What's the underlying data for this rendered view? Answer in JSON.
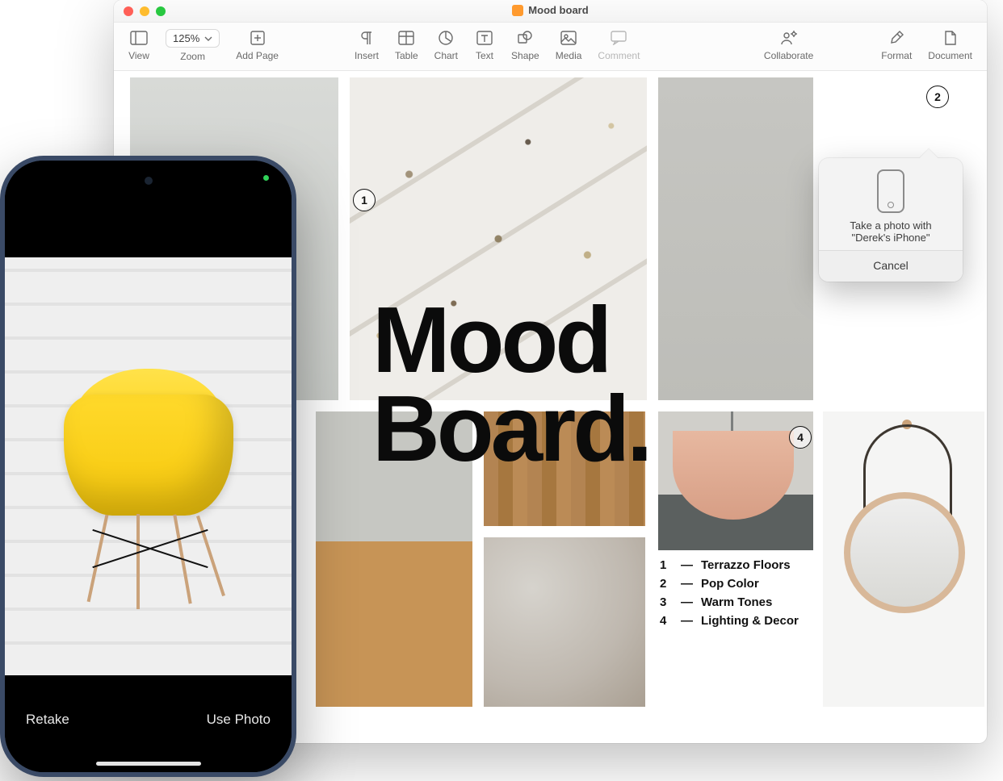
{
  "window": {
    "title": "Mood board"
  },
  "toolbar": {
    "view": "View",
    "zoom_value": "125%",
    "zoom_label": "Zoom",
    "add_page": "Add Page",
    "insert": "Insert",
    "table": "Table",
    "chart": "Chart",
    "text": "Text",
    "shape": "Shape",
    "media": "Media",
    "comment": "Comment",
    "collaborate": "Collaborate",
    "format": "Format",
    "document": "Document"
  },
  "document": {
    "title_line1": "Mood",
    "title_line2": "Board.",
    "callouts": {
      "c1": "1",
      "c2": "2",
      "c4": "4"
    },
    "legend": [
      {
        "n": "1",
        "label": "Terrazzo Floors"
      },
      {
        "n": "2",
        "label": "Pop Color"
      },
      {
        "n": "3",
        "label": "Warm Tones"
      },
      {
        "n": "4",
        "label": "Lighting & Decor"
      }
    ]
  },
  "popover": {
    "line1": "Take a photo with",
    "line2": "\"Derek's iPhone\"",
    "cancel": "Cancel"
  },
  "iphone": {
    "retake": "Retake",
    "use_photo": "Use Photo"
  }
}
